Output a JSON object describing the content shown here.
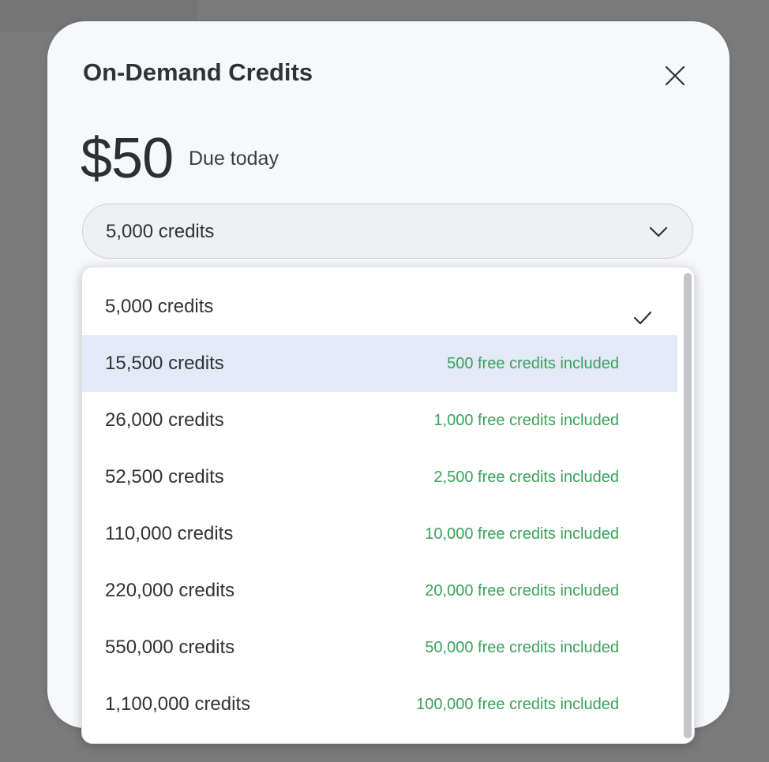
{
  "modal": {
    "title": "On-Demand Credits",
    "close_icon": "close-icon",
    "price": {
      "amount": "$50",
      "caption": "Due today"
    },
    "select": {
      "value": "5,000 credits",
      "icon": "chevron-down-icon"
    }
  },
  "dropdown": {
    "selected_index": 0,
    "highlighted_index": 1,
    "check_icon": "checkmark-icon",
    "options": [
      {
        "label": "5,000 credits",
        "bonus": ""
      },
      {
        "label": "15,500 credits",
        "bonus": "500 free credits included"
      },
      {
        "label": "26,000 credits",
        "bonus": "1,000 free credits included"
      },
      {
        "label": "52,500 credits",
        "bonus": "2,500 free credits included"
      },
      {
        "label": "110,000 credits",
        "bonus": "10,000 free credits included"
      },
      {
        "label": "220,000 credits",
        "bonus": "20,000 free credits included"
      },
      {
        "label": "550,000 credits",
        "bonus": "50,000 free credits included"
      },
      {
        "label": "1,100,000 credits",
        "bonus": "100,000 free credits included"
      }
    ]
  },
  "colors": {
    "overlay": "#7b7b7b",
    "modal_background": "#f7f8fb",
    "text_primary": "#2f3237",
    "bonus_text": "#3aa15b",
    "highlight_row": "#e3e9f6",
    "scrollbar": "#c3c5c8"
  }
}
